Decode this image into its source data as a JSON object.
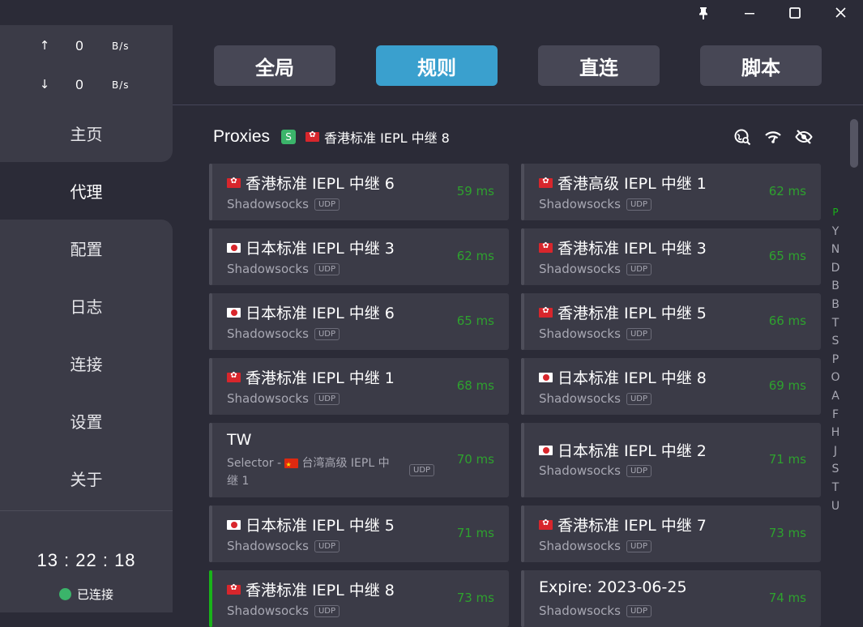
{
  "window": {
    "pin_icon": "pin-icon",
    "minimize_icon": "minimize-icon",
    "maximize_icon": "maximize-icon",
    "close_icon": "close-icon"
  },
  "traffic": {
    "up_arrow": "↑",
    "up_value": "0",
    "up_unit": "B/s",
    "down_arrow": "↓",
    "down_value": "0",
    "down_unit": "B/s"
  },
  "nav": {
    "items": [
      {
        "label": "主页"
      },
      {
        "label": "代理"
      },
      {
        "label": "配置"
      },
      {
        "label": "日志"
      },
      {
        "label": "连接"
      },
      {
        "label": "设置"
      },
      {
        "label": "关于"
      }
    ],
    "active_index": 1
  },
  "clock": "13 : 22 : 18",
  "status": {
    "label": "已连接",
    "color": "#3bb46a"
  },
  "modes": {
    "items": [
      {
        "label": "全局"
      },
      {
        "label": "规则"
      },
      {
        "label": "直连"
      },
      {
        "label": "脚本"
      }
    ],
    "active_index": 1,
    "accent": "#3aa0ce"
  },
  "proxies": {
    "title": "Proxies",
    "badge": "S",
    "selected": "香港标准 IEPL 中继 8",
    "header_icons": [
      "search-location-icon",
      "wifi-speed-icon",
      "eye-off-icon"
    ]
  },
  "cards": [
    {
      "name": "香港标准 IEPL 中继 6",
      "flag": "hk",
      "type": "Shadowsocks",
      "udp": "UDP",
      "delay": "59 ms"
    },
    {
      "name": "香港高级 IEPL 中继 1",
      "flag": "hk",
      "type": "Shadowsocks",
      "udp": "UDP",
      "delay": "62 ms"
    },
    {
      "name": "日本标准 IEPL 中继 3",
      "flag": "jp",
      "type": "Shadowsocks",
      "udp": "UDP",
      "delay": "62 ms"
    },
    {
      "name": "香港标准 IEPL 中继 3",
      "flag": "hk",
      "type": "Shadowsocks",
      "udp": "UDP",
      "delay": "65 ms"
    },
    {
      "name": "日本标准 IEPL 中继 6",
      "flag": "jp",
      "type": "Shadowsocks",
      "udp": "UDP",
      "delay": "65 ms"
    },
    {
      "name": "香港标准 IEPL 中继 5",
      "flag": "hk",
      "type": "Shadowsocks",
      "udp": "UDP",
      "delay": "66 ms"
    },
    {
      "name": "香港标准 IEPL 中继 1",
      "flag": "hk",
      "type": "Shadowsocks",
      "udp": "UDP",
      "delay": "68 ms"
    },
    {
      "name": "日本标准 IEPL 中继 8",
      "flag": "jp",
      "type": "Shadowsocks",
      "udp": "UDP",
      "delay": "69 ms"
    },
    {
      "name": "TW",
      "flag": "",
      "type_prefix": "Selector - ",
      "type_flag": "cn",
      "type_line1": "台湾高级 IEPL 中",
      "type_line2": "继 1",
      "udp": "UDP",
      "delay": "70 ms"
    },
    {
      "name": "日本标准 IEPL 中继 2",
      "flag": "jp",
      "type": "Shadowsocks",
      "udp": "UDP",
      "delay": "71 ms"
    },
    {
      "name": "日本标准 IEPL 中继 5",
      "flag": "jp",
      "type": "Shadowsocks",
      "udp": "UDP",
      "delay": "71 ms"
    },
    {
      "name": "香港标准 IEPL 中继 7",
      "flag": "hk",
      "type": "Shadowsocks",
      "udp": "UDP",
      "delay": "73 ms"
    },
    {
      "name": "香港标准 IEPL 中继 8",
      "flag": "hk",
      "type": "Shadowsocks",
      "udp": "UDP",
      "delay": "73 ms",
      "active": true
    },
    {
      "name": "Expire: 2023-06-25",
      "flag": "",
      "type": "Shadowsocks",
      "udp": "UDP",
      "delay": "74 ms"
    }
  ],
  "alphabet": [
    "P",
    "Y",
    "N",
    "D",
    "B",
    "B",
    "T",
    "S",
    "P",
    "O",
    "A",
    "F",
    "H",
    "J",
    "S",
    "T",
    "U"
  ],
  "alphabet_current": 0
}
